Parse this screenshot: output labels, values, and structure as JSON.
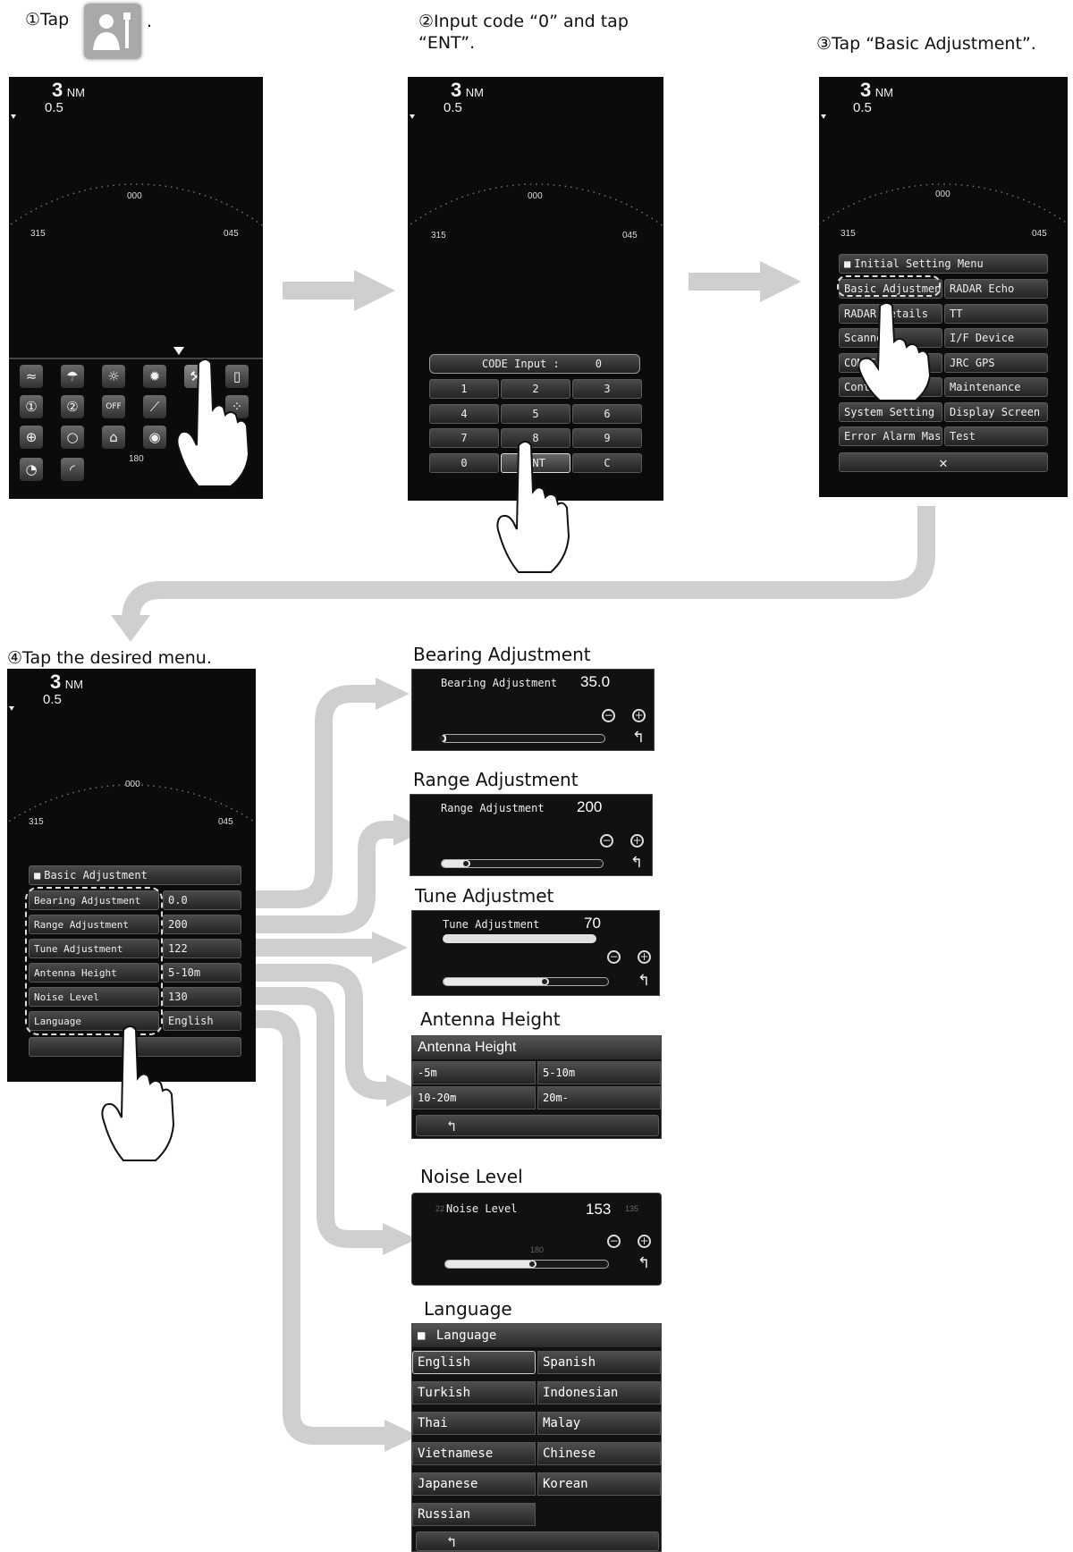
{
  "steps": {
    "s1_pre": "①Tap",
    "s1_post": ".",
    "s2_line1": "②Input code “0” and tap",
    "s2_line2": "“ENT”.",
    "s3": "③Tap “Basic Adjustment”.",
    "s4": "④Tap the desired menu."
  },
  "radar": {
    "range": "3",
    "unit": "NM",
    "ring": "0.5",
    "b000": "000",
    "b315": "315",
    "b045": "045",
    "b180": "180"
  },
  "code_panel": {
    "label": "CODE Input :",
    "value": "0",
    "keys": [
      "1",
      "2",
      "3",
      "4",
      "5",
      "6",
      "7",
      "8",
      "9",
      "0",
      "ENT",
      "C"
    ]
  },
  "init_menu": {
    "title": "Initial Setting Menu",
    "items": [
      "Basic Adjustment",
      "RADAR Echo",
      "RADAR Details",
      "TT",
      "Scanner",
      "I/F Device",
      "COM Setting",
      "JRC GPS",
      "Control",
      "Maintenance",
      "System Setting",
      "Display Screen",
      "Error Alarm Mask",
      "Test"
    ],
    "close": "✕"
  },
  "basic_menu": {
    "title": "Basic Adjustment",
    "rows": [
      {
        "label": "Bearing Adjustment",
        "value": "0.0"
      },
      {
        "label": "Range Adjustment",
        "value": "200"
      },
      {
        "label": "Tune Adjustment",
        "value": "122"
      },
      {
        "label": "Antenna Height",
        "value": "5-10m"
      },
      {
        "label": "Noise Level",
        "value": "130"
      },
      {
        "label": "Language",
        "value": "English"
      }
    ],
    "back": "↰"
  },
  "panels": {
    "bearing": {
      "caption": "Bearing Adjustment",
      "title": "Bearing Adjustment",
      "value": "35.0",
      "level": 0.03
    },
    "range": {
      "caption": "Range Adjustment",
      "title": "Range Adjustment",
      "value": "200",
      "level": 0.18
    },
    "tune": {
      "caption": "Tune Adjustmet",
      "title": "Tune Adjustment",
      "value": "70",
      "level": 0.64
    },
    "antenna": {
      "caption": "Antenna Height",
      "title": "Antenna Height",
      "options": [
        "-5m",
        "5-10m",
        "10-20m",
        "20m-"
      ]
    },
    "noise": {
      "caption": "Noise Level",
      "title": "Noise Level",
      "value": "153",
      "dim_left": "22",
      "dim_right": "135",
      "dim_mid": "180",
      "level": 0.56
    },
    "language": {
      "caption": "Language",
      "title": "Language",
      "options": [
        "English",
        "Spanish",
        "Turkish",
        "Indonesian",
        "Thai",
        "Malay",
        "Vietnamese",
        "Chinese",
        "Japanese",
        "Korean",
        "Russian"
      ]
    }
  },
  "icons": [
    "wave-icon",
    "rain-icon",
    "sun-icon",
    "brightness-icon",
    "maintenance-person-icon",
    "screen-icon",
    "user1-icon",
    "user2-icon",
    "power-off-icon",
    "line-icon",
    "dot-icon",
    "cross-heading-icon",
    "circle-icon",
    "antenna-icon",
    "location-pin-icon",
    "radar-sweep-icon",
    "curve-icon"
  ],
  "colors": {
    "screen_bg": "#0b0b0b",
    "arrow": "#cfcfcf",
    "button": "#3a3a3a"
  }
}
